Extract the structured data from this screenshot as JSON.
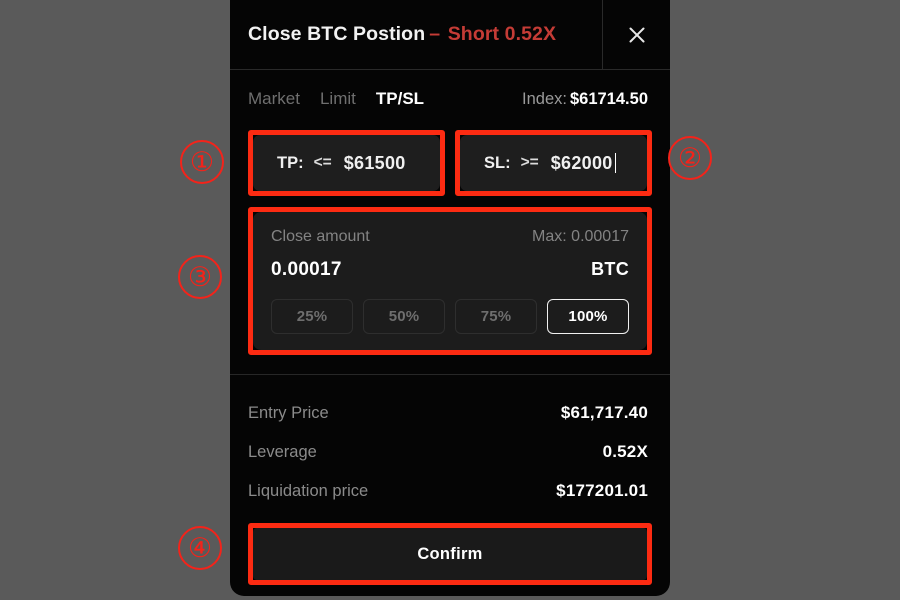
{
  "dialog": {
    "header": {
      "title": "Close BTC Postion",
      "separator": "–",
      "side": "Short 0.52X",
      "close_icon": "close-icon"
    },
    "tabs": [
      {
        "label": "Market",
        "active": false
      },
      {
        "label": "Limit",
        "active": false
      },
      {
        "label": "TP/SL",
        "active": true
      }
    ],
    "index": {
      "label": "Index:",
      "value": "$61714.50"
    },
    "tp_field": {
      "label": "TP:",
      "operator": "<=",
      "value": "$61500"
    },
    "sl_field": {
      "label": "SL:",
      "operator": ">=",
      "value": "$62000"
    },
    "close_amount": {
      "label": "Close amount",
      "max_label": "Max: 0.00017",
      "value": "0.00017",
      "unit": "BTC",
      "percent_options": [
        {
          "label": "25%",
          "selected": false
        },
        {
          "label": "50%",
          "selected": false
        },
        {
          "label": "75%",
          "selected": false
        },
        {
          "label": "100%",
          "selected": true
        }
      ]
    },
    "details": [
      {
        "label": "Entry Price",
        "value": "$61,717.40"
      },
      {
        "label": "Leverage",
        "value": "0.52X"
      },
      {
        "label": "Liquidation price",
        "value": "$177201.01"
      }
    ],
    "confirm_label": "Confirm"
  },
  "annotations": {
    "markers": [
      {
        "number": "①"
      },
      {
        "number": "②"
      },
      {
        "number": "③"
      },
      {
        "number": "④"
      }
    ],
    "highlight_color": "#fc2b12"
  }
}
